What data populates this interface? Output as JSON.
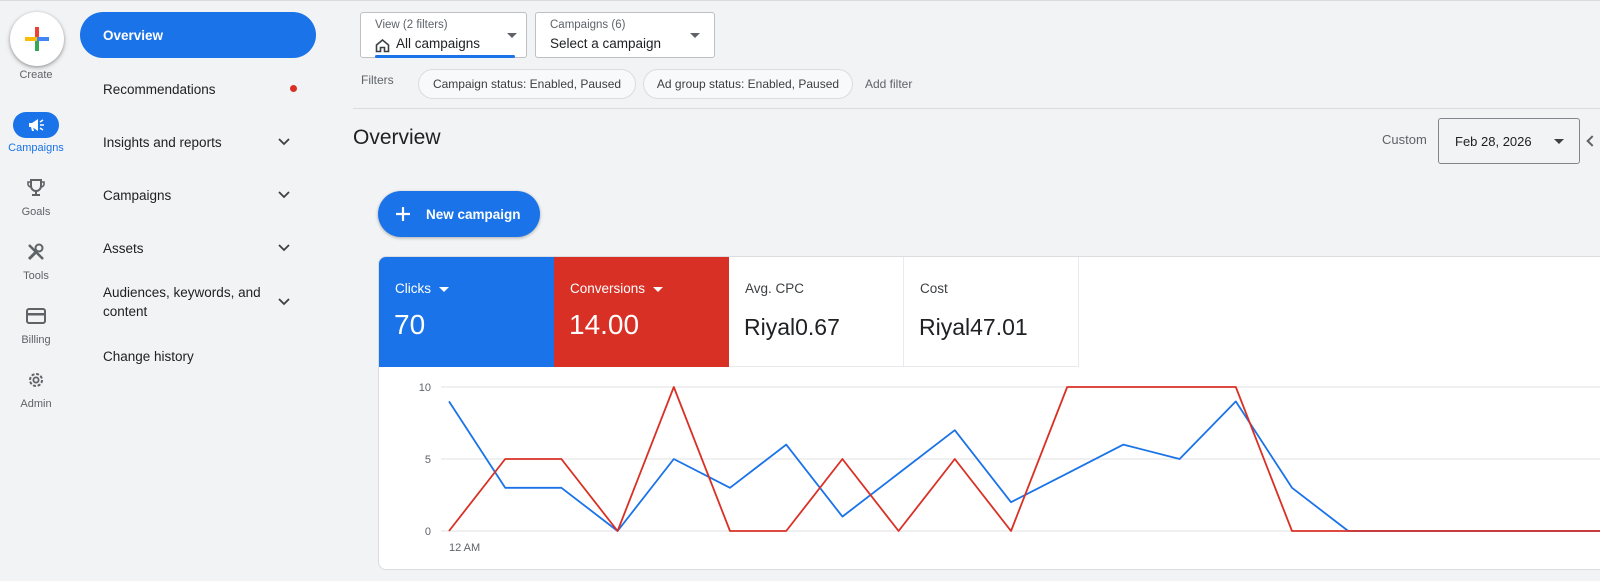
{
  "rail": {
    "create_label": "Create",
    "items": [
      {
        "label": "Campaigns",
        "icon": "megaphone-icon",
        "active": true
      },
      {
        "label": "Goals",
        "icon": "trophy-icon",
        "active": false
      },
      {
        "label": "Tools",
        "icon": "tools-icon",
        "active": false
      },
      {
        "label": "Billing",
        "icon": "credit-card-icon",
        "active": false
      },
      {
        "label": "Admin",
        "icon": "gear-icon",
        "active": false
      }
    ]
  },
  "nav": {
    "items": [
      {
        "label": "Overview",
        "active": true
      },
      {
        "label": "Recommendations",
        "badge": "red-dot"
      },
      {
        "label": "Insights and reports",
        "expandable": true
      },
      {
        "label": "Campaigns",
        "expandable": true
      },
      {
        "label": "Assets",
        "expandable": true
      },
      {
        "label": "Audiences, keywords, and content",
        "expandable": true
      },
      {
        "label": "Change history"
      }
    ]
  },
  "filters": {
    "view": {
      "caption": "View (2 filters)",
      "value": "All campaigns"
    },
    "campaigns": {
      "caption": "Campaigns (6)",
      "value": "Select a campaign"
    },
    "label": "Filters",
    "chips": [
      "Campaign status: Enabled, Paused",
      "Ad group status: Enabled, Paused"
    ],
    "add_filter": "Add filter"
  },
  "header": {
    "title": "Overview",
    "range_label": "Custom",
    "date": "Feb 28, 2026"
  },
  "new_campaign_label": "New campaign",
  "metrics": [
    {
      "label": "Clicks",
      "value": "70",
      "color": "#1a73e8",
      "dropdown": true
    },
    {
      "label": "Conversions",
      "value": "14.00",
      "color": "#d93025",
      "dropdown": true
    },
    {
      "label": "Avg. CPC",
      "value": "Riyal0.67"
    },
    {
      "label": "Cost",
      "value": "Riyal47.01"
    }
  ],
  "chart_data": {
    "type": "line",
    "x_first_label": "12 AM",
    "yticks": [
      0,
      5,
      10
    ],
    "ylim": [
      0,
      10
    ],
    "grid": true,
    "series": [
      {
        "color": "#1a73e8",
        "values": [
          9,
          3,
          3,
          0,
          5,
          3,
          6,
          1,
          4,
          7,
          2,
          4,
          6,
          5,
          9,
          3,
          0,
          0,
          0,
          0,
          0,
          0,
          0
        ]
      },
      {
        "color": "#d93025",
        "values": [
          0,
          5,
          5,
          0,
          10,
          0,
          0,
          5,
          0,
          5,
          0,
          10,
          10,
          10,
          10,
          0,
          0,
          0,
          0,
          0,
          0,
          0,
          0
        ]
      }
    ]
  }
}
